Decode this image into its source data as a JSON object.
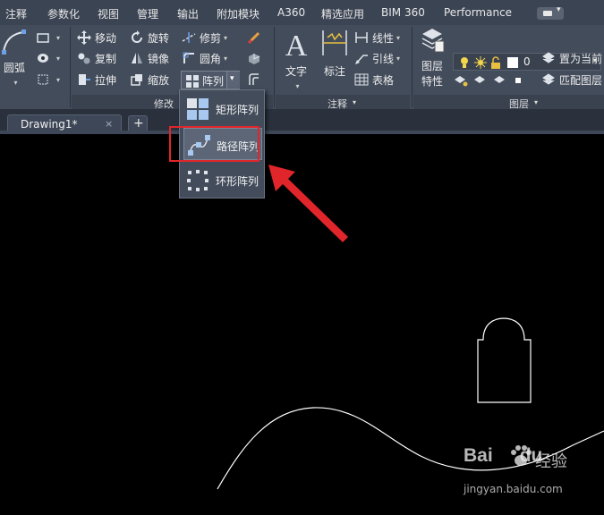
{
  "menu_tabs": [
    "注释",
    "参数化",
    "视图",
    "管理",
    "输出",
    "附加模块",
    "A360",
    "精选应用",
    "BIM 360",
    "Performance"
  ],
  "ribbon": {
    "draw": {
      "arc_label": "圆弧"
    },
    "modify": {
      "title": "修改",
      "move": "移动",
      "rotate": "旋转",
      "trim": "修剪",
      "copy": "复制",
      "mirror": "镜像",
      "fillet": "圆角",
      "stretch": "拉伸",
      "scale": "缩放",
      "array": "阵列"
    },
    "annotation": {
      "title": "注释",
      "text": "文字",
      "dimension": "标注",
      "linear": "线性",
      "leader": "引线",
      "table": "表格"
    },
    "layers": {
      "title": "图层",
      "layer_properties": "图层\n特性",
      "layer_properties_line1": "图层",
      "layer_properties_line2": "特性",
      "current_layer": "0",
      "set_current": "置为当前",
      "match_layer": "匹配图层"
    }
  },
  "file_tabs": {
    "document": "Drawing1*",
    "close_symbol": "×",
    "new_tab_symbol": "+"
  },
  "array_dropdown": {
    "items": [
      {
        "label": "矩形阵列",
        "icon": "rectangular-array-icon"
      },
      {
        "label": "路径阵列",
        "icon": "path-array-icon",
        "highlighted": true
      },
      {
        "label": "环形阵列",
        "icon": "polar-array-icon"
      }
    ]
  },
  "watermark": {
    "brand": "Bai",
    "brand_suffix": "du",
    "cn": "经验",
    "url": "jingyan.baidu.com"
  },
  "colors": {
    "ribbon_bg": "#434c5b",
    "tabbar_bg": "#3b4453",
    "canvas_bg": "#000000",
    "highlight_box": "#e0262b",
    "arrow": "#e0262b",
    "drawing_lines": "#ffffff"
  }
}
